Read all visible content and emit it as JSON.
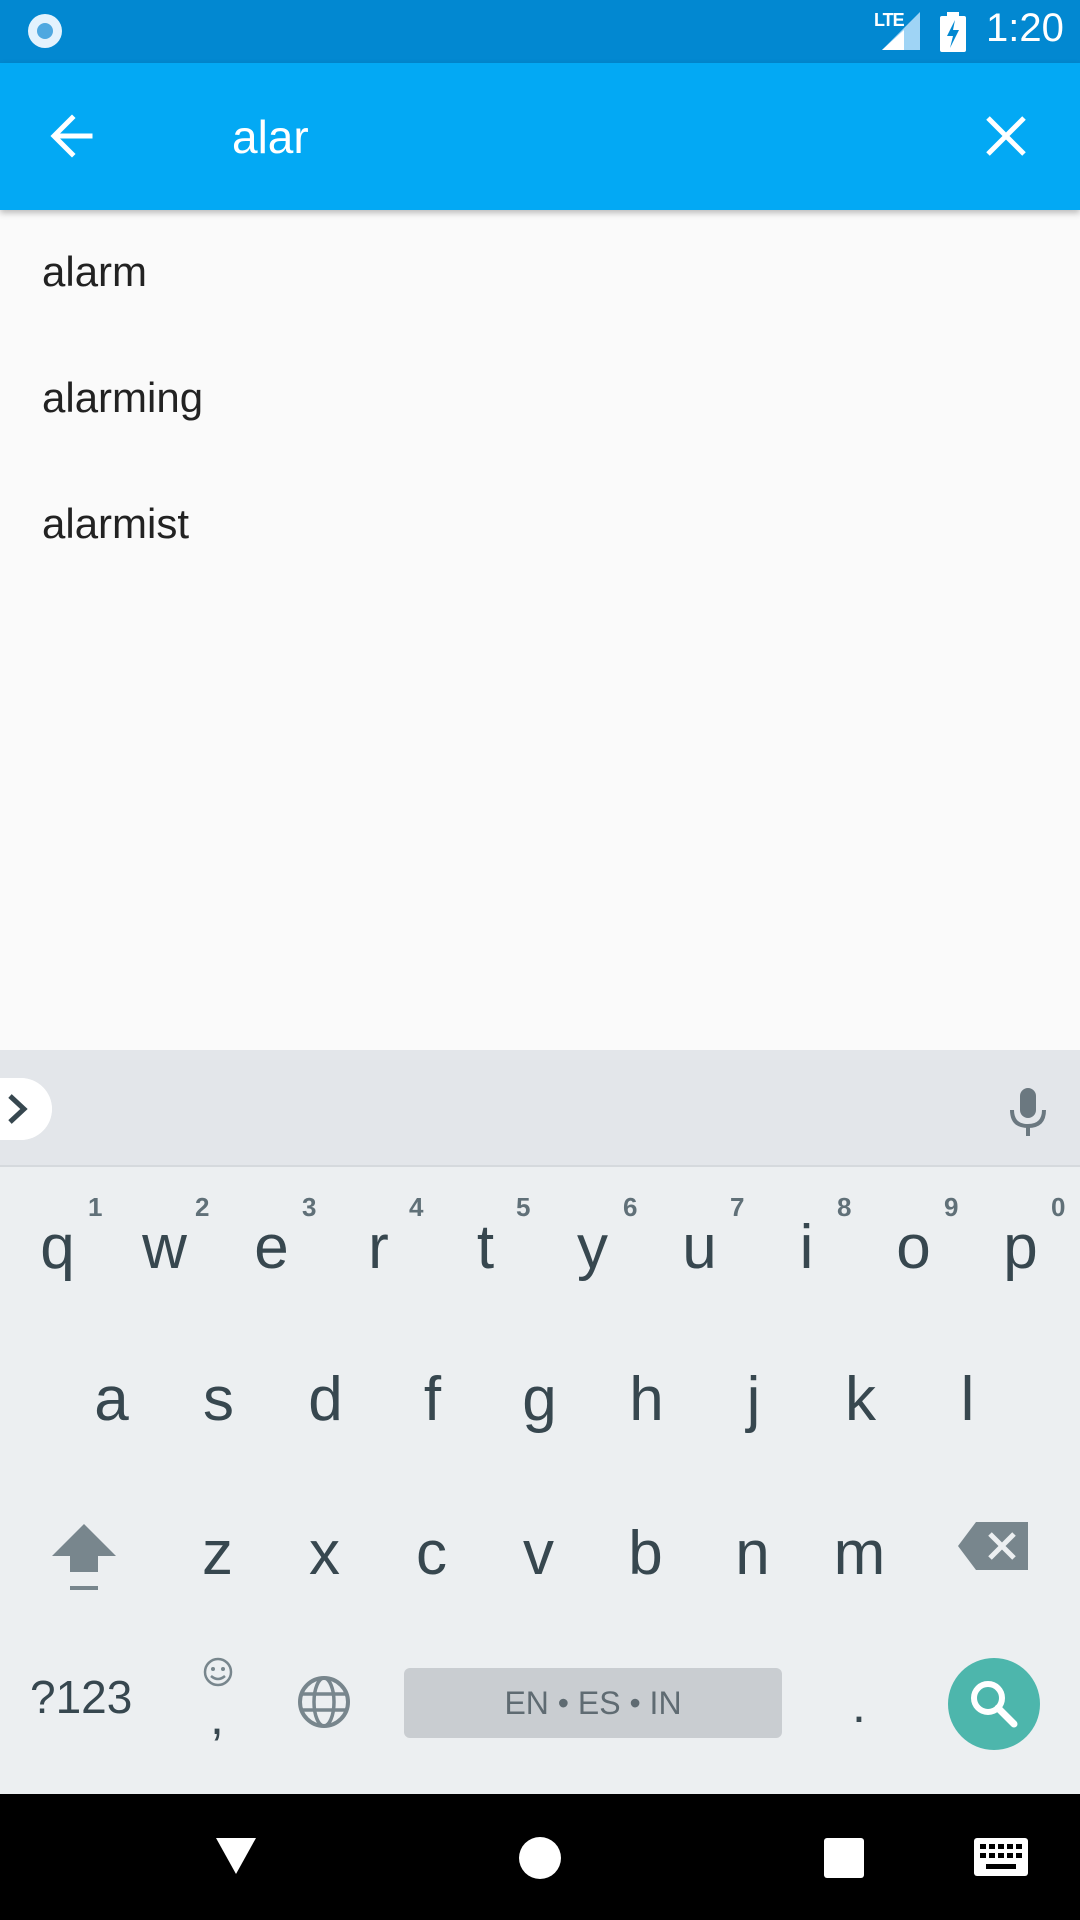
{
  "status_bar": {
    "network": "LTE",
    "time": "1:20"
  },
  "app_bar": {
    "query": "alar"
  },
  "suggestions": [
    "alarm",
    "alarming",
    "alarmist"
  ],
  "keyboard": {
    "row1": [
      {
        "key": "q",
        "hint": "1"
      },
      {
        "key": "w",
        "hint": "2"
      },
      {
        "key": "e",
        "hint": "3"
      },
      {
        "key": "r",
        "hint": "4"
      },
      {
        "key": "t",
        "hint": "5"
      },
      {
        "key": "y",
        "hint": "6"
      },
      {
        "key": "u",
        "hint": "7"
      },
      {
        "key": "i",
        "hint": "8"
      },
      {
        "key": "o",
        "hint": "9"
      },
      {
        "key": "p",
        "hint": "0"
      }
    ],
    "row2": [
      "a",
      "s",
      "d",
      "f",
      "g",
      "h",
      "j",
      "k",
      "l"
    ],
    "row3": [
      "z",
      "x",
      "c",
      "v",
      "b",
      "n",
      "m"
    ],
    "symbols_label": "?123",
    "emoji_label": ",",
    "space_label": "EN • ES • IN",
    "period_label": "."
  },
  "colors": {
    "status_bar": "#0288D1",
    "app_bar": "#03A9F4",
    "search_key": "#4DB6AC"
  }
}
